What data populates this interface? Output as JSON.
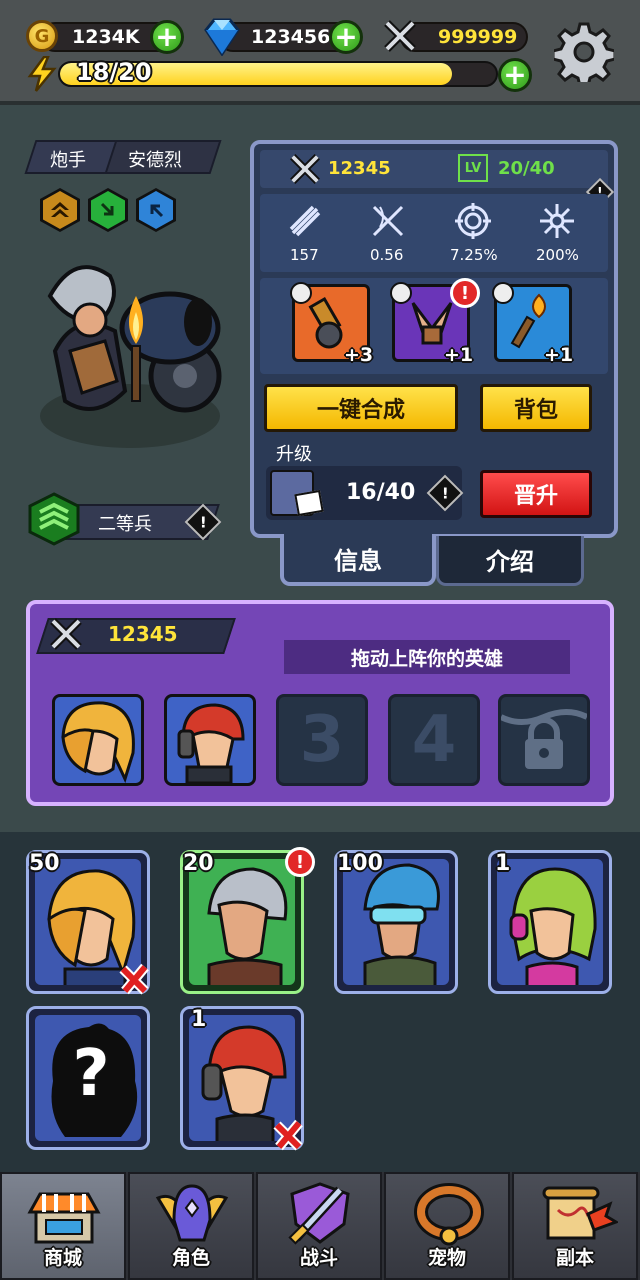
{
  "currency": {
    "gold": "1234K",
    "gems": "123456",
    "power": "999999",
    "energy": "18/20",
    "energy_fraction": 0.9
  },
  "hero": {
    "class": "炮手",
    "name": "安德烈",
    "rank": "二等兵"
  },
  "info": {
    "power": "12345",
    "level_tag": "LV",
    "level": "20/40",
    "stats": [
      "157",
      "0.56",
      "7.25%",
      "200%"
    ],
    "equipment": [
      "+3",
      "+1",
      "+1"
    ],
    "btn_merge": "一键合成",
    "btn_bag": "背包",
    "upgrade_label": "升级",
    "shards": "16/40",
    "btn_promote": "晋升",
    "tab_info": "信息",
    "tab_intro": "介绍"
  },
  "team": {
    "power": "12345",
    "hint": "拖动上阵你的英雄",
    "slots": [
      "3",
      "4"
    ]
  },
  "roster": {
    "levels": [
      "50",
      "20",
      "100",
      "1",
      "1"
    ],
    "unknown_mark": "?"
  },
  "nav": [
    "商城",
    "角色",
    "战斗",
    "宠物",
    "副本"
  ],
  "colors": {
    "accent_green": "#6fe04a",
    "energy_yellow": "#ffe43a",
    "team_purple": "#7446b6",
    "panel_navy": "#2b3a56",
    "promote_red": "#d21414"
  }
}
